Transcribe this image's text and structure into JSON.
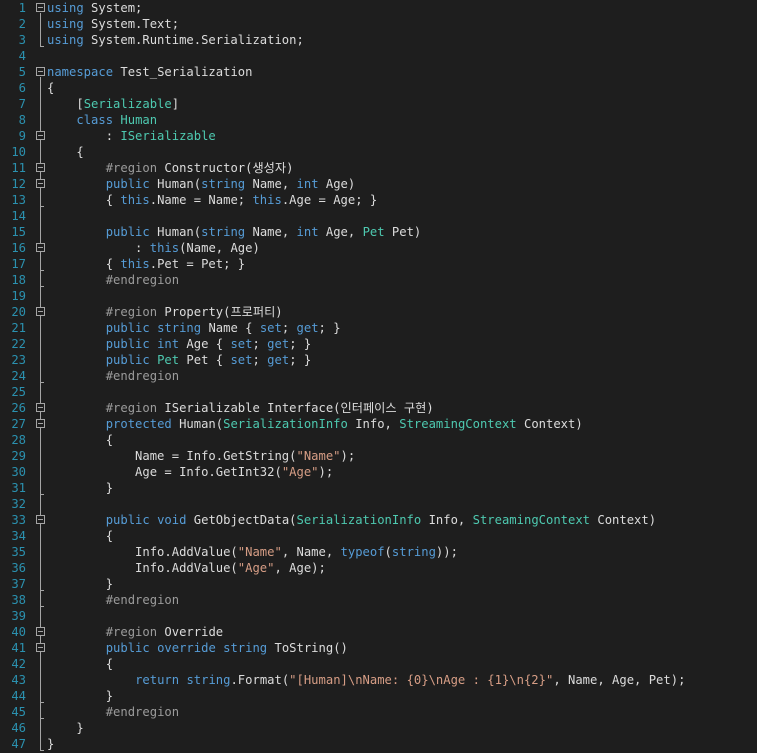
{
  "editor": {
    "language": "csharp",
    "colors": {
      "background": "#1e1e1e",
      "line_number": "#2b91af",
      "keyword": "#569cd6",
      "type": "#4ec9b0",
      "string": "#d69d85",
      "preprocessor": "#9b9b9b",
      "plain": "#dcdcdc"
    },
    "lines": [
      {
        "num": "1",
        "fold": true,
        "tokens": [
          [
            "kw",
            "using"
          ],
          [
            "pl",
            " System;"
          ]
        ]
      },
      {
        "num": "2",
        "fold": false,
        "tokens": [
          [
            "kw",
            "using"
          ],
          [
            "pl",
            " System.Text;"
          ]
        ]
      },
      {
        "num": "3",
        "fold": false,
        "tokens": [
          [
            "kw",
            "using"
          ],
          [
            "pl",
            " System.Runtime.Serialization;"
          ]
        ]
      },
      {
        "num": "4",
        "fold": false,
        "tokens": []
      },
      {
        "num": "5",
        "fold": true,
        "tokens": [
          [
            "kw",
            "namespace"
          ],
          [
            "pl",
            " Test_Serialization"
          ]
        ]
      },
      {
        "num": "6",
        "fold": false,
        "tokens": [
          [
            "pl",
            "{"
          ]
        ]
      },
      {
        "num": "7",
        "fold": false,
        "tokens": [
          [
            "pl",
            "    ["
          ],
          [
            "ty",
            "Serializable"
          ],
          [
            "pl",
            "]"
          ]
        ]
      },
      {
        "num": "8",
        "fold": false,
        "tokens": [
          [
            "pl",
            "    "
          ],
          [
            "kw",
            "class"
          ],
          [
            "pl",
            " "
          ],
          [
            "ty",
            "Human"
          ]
        ]
      },
      {
        "num": "9",
        "fold": true,
        "tokens": [
          [
            "pl",
            "        : "
          ],
          [
            "ty",
            "ISerializable"
          ]
        ]
      },
      {
        "num": "10",
        "fold": false,
        "tokens": [
          [
            "pl",
            "    {"
          ]
        ]
      },
      {
        "num": "11",
        "fold": true,
        "tokens": [
          [
            "pl",
            "        "
          ],
          [
            "pp",
            "#region"
          ],
          [
            "pl",
            " Constructor(생성자)"
          ]
        ]
      },
      {
        "num": "12",
        "fold": true,
        "tokens": [
          [
            "pl",
            "        "
          ],
          [
            "kw",
            "public"
          ],
          [
            "pl",
            " Human("
          ],
          [
            "kw",
            "string"
          ],
          [
            "pl",
            " Name, "
          ],
          [
            "kw",
            "int"
          ],
          [
            "pl",
            " Age)"
          ]
        ]
      },
      {
        "num": "13",
        "fold": false,
        "tokens": [
          [
            "pl",
            "        { "
          ],
          [
            "kw",
            "this"
          ],
          [
            "pl",
            ".Name = Name; "
          ],
          [
            "kw",
            "this"
          ],
          [
            "pl",
            ".Age = Age; }"
          ]
        ]
      },
      {
        "num": "14",
        "fold": false,
        "tokens": []
      },
      {
        "num": "15",
        "fold": false,
        "tokens": [
          [
            "pl",
            "        "
          ],
          [
            "kw",
            "public"
          ],
          [
            "pl",
            " Human("
          ],
          [
            "kw",
            "string"
          ],
          [
            "pl",
            " Name, "
          ],
          [
            "kw",
            "int"
          ],
          [
            "pl",
            " Age, "
          ],
          [
            "ty",
            "Pet"
          ],
          [
            "pl",
            " Pet)"
          ]
        ]
      },
      {
        "num": "16",
        "fold": true,
        "tokens": [
          [
            "pl",
            "            : "
          ],
          [
            "kw",
            "this"
          ],
          [
            "pl",
            "(Name, Age)"
          ]
        ]
      },
      {
        "num": "17",
        "fold": false,
        "tokens": [
          [
            "pl",
            "        { "
          ],
          [
            "kw",
            "this"
          ],
          [
            "pl",
            ".Pet = Pet; }"
          ]
        ]
      },
      {
        "num": "18",
        "fold": false,
        "tokens": [
          [
            "pl",
            "        "
          ],
          [
            "pp",
            "#endregion"
          ]
        ]
      },
      {
        "num": "19",
        "fold": false,
        "tokens": []
      },
      {
        "num": "20",
        "fold": true,
        "tokens": [
          [
            "pl",
            "        "
          ],
          [
            "pp",
            "#region"
          ],
          [
            "pl",
            " Property(프로퍼티)"
          ]
        ]
      },
      {
        "num": "21",
        "fold": false,
        "tokens": [
          [
            "pl",
            "        "
          ],
          [
            "kw",
            "public"
          ],
          [
            "pl",
            " "
          ],
          [
            "kw",
            "string"
          ],
          [
            "pl",
            " Name { "
          ],
          [
            "kw",
            "set"
          ],
          [
            "pl",
            "; "
          ],
          [
            "kw",
            "get"
          ],
          [
            "pl",
            "; }"
          ]
        ]
      },
      {
        "num": "22",
        "fold": false,
        "tokens": [
          [
            "pl",
            "        "
          ],
          [
            "kw",
            "public"
          ],
          [
            "pl",
            " "
          ],
          [
            "kw",
            "int"
          ],
          [
            "pl",
            " Age { "
          ],
          [
            "kw",
            "set"
          ],
          [
            "pl",
            "; "
          ],
          [
            "kw",
            "get"
          ],
          [
            "pl",
            "; }"
          ]
        ]
      },
      {
        "num": "23",
        "fold": false,
        "tokens": [
          [
            "pl",
            "        "
          ],
          [
            "kw",
            "public"
          ],
          [
            "pl",
            " "
          ],
          [
            "ty",
            "Pet"
          ],
          [
            "pl",
            " Pet { "
          ],
          [
            "kw",
            "set"
          ],
          [
            "pl",
            "; "
          ],
          [
            "kw",
            "get"
          ],
          [
            "pl",
            "; }"
          ]
        ]
      },
      {
        "num": "24",
        "fold": false,
        "tokens": [
          [
            "pl",
            "        "
          ],
          [
            "pp",
            "#endregion"
          ]
        ]
      },
      {
        "num": "25",
        "fold": false,
        "tokens": []
      },
      {
        "num": "26",
        "fold": true,
        "tokens": [
          [
            "pl",
            "        "
          ],
          [
            "pp",
            "#region"
          ],
          [
            "pl",
            " ISerializable Interface(인터페이스 구현)"
          ]
        ]
      },
      {
        "num": "27",
        "fold": true,
        "tokens": [
          [
            "pl",
            "        "
          ],
          [
            "kw",
            "protected"
          ],
          [
            "pl",
            " Human("
          ],
          [
            "ty",
            "SerializationInfo"
          ],
          [
            "pl",
            " Info, "
          ],
          [
            "ty",
            "StreamingContext"
          ],
          [
            "pl",
            " Context)"
          ]
        ]
      },
      {
        "num": "28",
        "fold": false,
        "tokens": [
          [
            "pl",
            "        {"
          ]
        ]
      },
      {
        "num": "29",
        "fold": false,
        "tokens": [
          [
            "pl",
            "            Name = Info.GetString("
          ],
          [
            "st",
            "\"Name\""
          ],
          [
            "pl",
            ");"
          ]
        ]
      },
      {
        "num": "30",
        "fold": false,
        "tokens": [
          [
            "pl",
            "            Age = Info.GetInt32("
          ],
          [
            "st",
            "\"Age\""
          ],
          [
            "pl",
            ");"
          ]
        ]
      },
      {
        "num": "31",
        "fold": false,
        "tokens": [
          [
            "pl",
            "        }"
          ]
        ]
      },
      {
        "num": "32",
        "fold": false,
        "tokens": []
      },
      {
        "num": "33",
        "fold": true,
        "tokens": [
          [
            "pl",
            "        "
          ],
          [
            "kw",
            "public"
          ],
          [
            "pl",
            " "
          ],
          [
            "kw",
            "void"
          ],
          [
            "pl",
            " GetObjectData("
          ],
          [
            "ty",
            "SerializationInfo"
          ],
          [
            "pl",
            " Info, "
          ],
          [
            "ty",
            "StreamingContext"
          ],
          [
            "pl",
            " Context)"
          ]
        ]
      },
      {
        "num": "34",
        "fold": false,
        "tokens": [
          [
            "pl",
            "        {"
          ]
        ]
      },
      {
        "num": "35",
        "fold": false,
        "tokens": [
          [
            "pl",
            "            Info.AddValue("
          ],
          [
            "st",
            "\"Name\""
          ],
          [
            "pl",
            ", Name, "
          ],
          [
            "kw",
            "typeof"
          ],
          [
            "pl",
            "("
          ],
          [
            "kw",
            "string"
          ],
          [
            "pl",
            "));"
          ]
        ]
      },
      {
        "num": "36",
        "fold": false,
        "tokens": [
          [
            "pl",
            "            Info.AddValue("
          ],
          [
            "st",
            "\"Age\""
          ],
          [
            "pl",
            ", Age);"
          ]
        ]
      },
      {
        "num": "37",
        "fold": false,
        "tokens": [
          [
            "pl",
            "        }"
          ]
        ]
      },
      {
        "num": "38",
        "fold": false,
        "tokens": [
          [
            "pl",
            "        "
          ],
          [
            "pp",
            "#endregion"
          ]
        ]
      },
      {
        "num": "39",
        "fold": false,
        "tokens": []
      },
      {
        "num": "40",
        "fold": true,
        "tokens": [
          [
            "pl",
            "        "
          ],
          [
            "pp",
            "#region"
          ],
          [
            "pl",
            " Override"
          ]
        ]
      },
      {
        "num": "41",
        "fold": true,
        "tokens": [
          [
            "pl",
            "        "
          ],
          [
            "kw",
            "public"
          ],
          [
            "pl",
            " "
          ],
          [
            "kw",
            "override"
          ],
          [
            "pl",
            " "
          ],
          [
            "kw",
            "string"
          ],
          [
            "pl",
            " ToString()"
          ]
        ]
      },
      {
        "num": "42",
        "fold": false,
        "tokens": [
          [
            "pl",
            "        {"
          ]
        ]
      },
      {
        "num": "43",
        "fold": false,
        "tokens": [
          [
            "pl",
            "            "
          ],
          [
            "kw",
            "return"
          ],
          [
            "pl",
            " "
          ],
          [
            "kw",
            "string"
          ],
          [
            "pl",
            ".Format("
          ],
          [
            "st",
            "\"[Human]\\nName: {0}\\nAge : {1}\\n{2}\""
          ],
          [
            "pl",
            ", Name, Age, Pet);"
          ]
        ]
      },
      {
        "num": "44",
        "fold": false,
        "tokens": [
          [
            "pl",
            "        }"
          ]
        ]
      },
      {
        "num": "45",
        "fold": false,
        "tokens": [
          [
            "pl",
            "        "
          ],
          [
            "pp",
            "#endregion"
          ]
        ]
      },
      {
        "num": "46",
        "fold": false,
        "tokens": [
          [
            "pl",
            "    }"
          ]
        ]
      },
      {
        "num": "47",
        "fold": false,
        "tokens": [
          [
            "pl",
            "}"
          ]
        ]
      }
    ]
  }
}
